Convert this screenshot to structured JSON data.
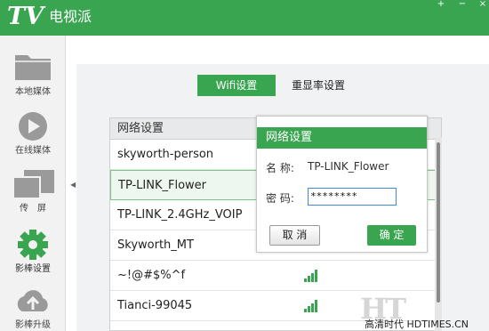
{
  "app": {
    "logo": "TV",
    "title": "电视派"
  },
  "window_controls": [
    "+",
    "−",
    "×"
  ],
  "sidebar": {
    "items": [
      {
        "label": "本地媒体",
        "icon": "folder-icon"
      },
      {
        "label": "在线媒体",
        "icon": "play-icon"
      },
      {
        "label": "传　屏",
        "icon": "screen-cast-icon"
      },
      {
        "label": "影棒设置",
        "icon": "gear-icon",
        "active": true
      },
      {
        "label": "影棒升级",
        "icon": "cloud-upload-icon"
      }
    ]
  },
  "tabs": [
    {
      "label": "Wifi设置",
      "active": true
    },
    {
      "label": "重显率设置",
      "active": false
    }
  ],
  "network_list": {
    "header": "网络设置",
    "rows": [
      {
        "ssid": "skyworth-person"
      },
      {
        "ssid": "TP-LINK_Flower",
        "selected": true
      },
      {
        "ssid": "TP-LINK_2.4GHz_VOIP"
      },
      {
        "ssid": "Skyworth_MT"
      },
      {
        "ssid": "~!@#$%^f"
      },
      {
        "ssid": "Tianci-99045"
      }
    ]
  },
  "dialog": {
    "title": "网络设置",
    "name_label": "名  称:",
    "name_value": "TP-LINK_Flower",
    "password_label": "密  码:",
    "password_value": "********",
    "cancel_label": "取 消",
    "ok_label": "确 定"
  },
  "watermark": {
    "logo": "HT",
    "text": "高清时代 HDTIMES.CN"
  },
  "colors": {
    "accent": "#3aa551",
    "focus": "#3c8de2"
  }
}
